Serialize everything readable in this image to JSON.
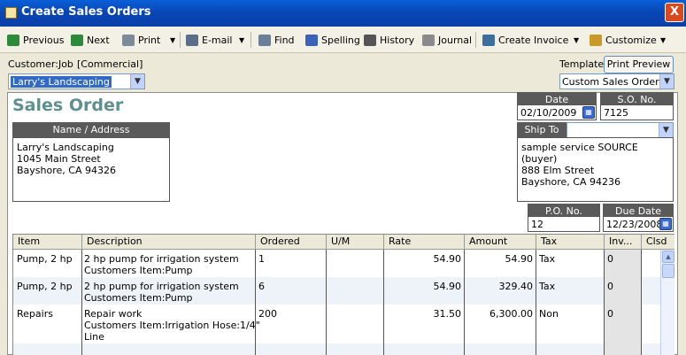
{
  "window": {
    "title": "Create Sales Orders",
    "close": "X"
  },
  "toolbar": {
    "previous": "Previous",
    "next": "Next",
    "print": "Print",
    "email": "E-mail",
    "find": "Find",
    "spelling": "Spelling",
    "history": "History",
    "journal": "Journal",
    "create_invoice": "Create Invoice",
    "customize": "Customize",
    "dropdown": "▼"
  },
  "customer": {
    "label": "Customer:Job",
    "class_label": "[Commercial]",
    "value": "Larry's Landscaping"
  },
  "template": {
    "label": "Template",
    "print_preview": "Print Preview",
    "value": "Custom Sales Order"
  },
  "form": {
    "title": "Sales Order",
    "date_label": "Date",
    "date": "02/10/2009",
    "so_label": "S.O. No.",
    "so": "7125",
    "name_address_label": "Name / Address",
    "name_address": [
      "Larry's Landscaping",
      "1045 Main Street",
      "Bayshore, CA 94326"
    ],
    "ship_to_label": "Ship To",
    "ship_to": [
      "sample service SOURCE (buyer)",
      "888 Elm Street",
      "Bayshore, CA 94236"
    ],
    "po_label": "P.O. No.",
    "po": "12",
    "due_label": "Due Date",
    "due": "12/23/2008"
  },
  "table": {
    "headers": [
      "Item",
      "Description",
      "Ordered",
      "U/M",
      "Rate",
      "Amount",
      "Tax",
      "Inv...",
      "Clsd"
    ],
    "rows": [
      {
        "item": "Pump, 2 hp",
        "desc1": "2 hp pump for irrigation system",
        "desc2": "Customers Item:Pump",
        "desc3": "",
        "ordered": "1",
        "um": "",
        "rate": "54.90",
        "amount": "54.90",
        "tax": "Tax",
        "inv": "0"
      },
      {
        "item": "Pump, 2 hp",
        "desc1": "2 hp pump for irrigation system",
        "desc2": "Customers Item:Pump",
        "desc3": "",
        "ordered": "6",
        "um": "",
        "rate": "54.90",
        "amount": "329.40",
        "tax": "Tax",
        "inv": "0"
      },
      {
        "item": "Repairs",
        "desc1": "Repair work",
        "desc2": "Customers Item:Irrigation Hose:1/4\"",
        "desc3": "Line",
        "ordered": "200",
        "um": "",
        "rate": "31.50",
        "amount": "6,300.00",
        "tax": "Non",
        "inv": "0"
      }
    ]
  },
  "colors": {
    "title_bar": "#0a4fc8",
    "heading": "#5f8f8f",
    "header_bg": "#5a5a5a",
    "alt_row": "#eef3fa"
  }
}
